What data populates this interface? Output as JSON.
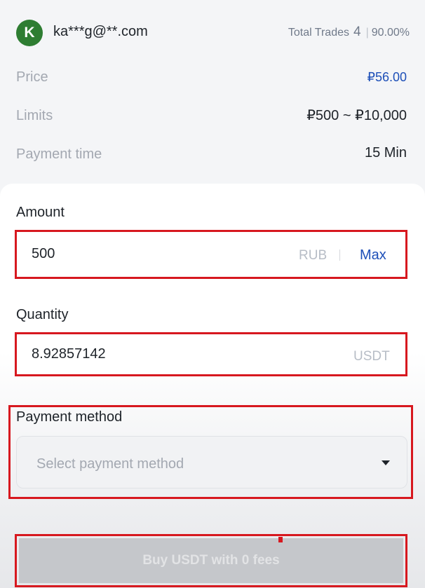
{
  "user": {
    "avatar_letter": "K",
    "email": "ka***g@**.com"
  },
  "stats": {
    "label": "Total Trades",
    "count": "4",
    "completion": "90.00%"
  },
  "info": {
    "price": {
      "label": "Price",
      "value": "₽56.00"
    },
    "limits": {
      "label": "Limits",
      "value": "₽500 ~ ₽10,000"
    },
    "payment_time": {
      "label": "Payment time",
      "value": "15 Min"
    }
  },
  "amount": {
    "label": "Amount",
    "value": "500",
    "unit": "RUB",
    "max_label": "Max"
  },
  "quantity": {
    "label": "Quantity",
    "value": "8.92857142",
    "unit": "USDT"
  },
  "payment_method": {
    "label": "Payment method",
    "placeholder": "Select payment method"
  },
  "buy_button": {
    "label": "Buy USDT with 0 fees"
  },
  "colors": {
    "accent_blue": "#1d4fb8",
    "avatar_green": "#2e7d32",
    "highlight_red": "#d7181f"
  }
}
